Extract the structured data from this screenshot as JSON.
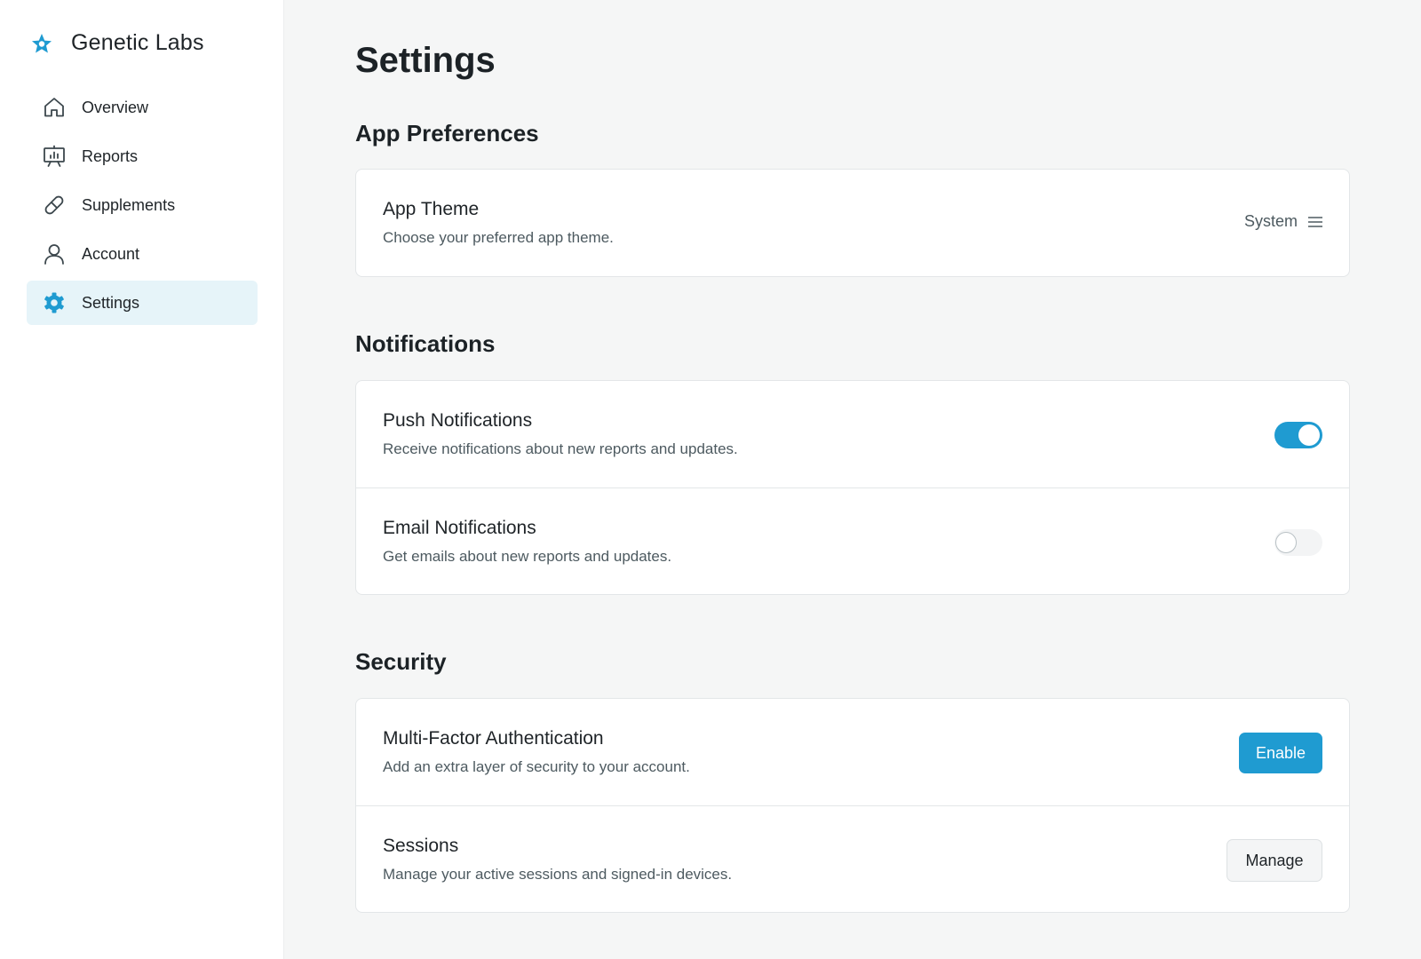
{
  "app": {
    "name": "Genetic Labs"
  },
  "colors": {
    "accent": "#1f9bd1",
    "active_bg": "#e6f4f9",
    "page_bg": "#f5f6f6"
  },
  "sidebar": {
    "items": [
      {
        "label": "Overview",
        "icon": "home-icon"
      },
      {
        "label": "Reports",
        "icon": "presentation-chart-icon"
      },
      {
        "label": "Supplements",
        "icon": "pill-icon"
      },
      {
        "label": "Account",
        "icon": "user-icon"
      },
      {
        "label": "Settings",
        "icon": "gear-icon",
        "active": true
      }
    ]
  },
  "page": {
    "title": "Settings"
  },
  "sections": {
    "app_preferences": {
      "title": "App Preferences",
      "theme": {
        "title": "App Theme",
        "description": "Choose your preferred app theme.",
        "value": "System",
        "icon": "menu-icon"
      }
    },
    "notifications": {
      "title": "Notifications",
      "push": {
        "title": "Push Notifications",
        "description": "Receive notifications about new reports and updates.",
        "enabled": true
      },
      "email": {
        "title": "Email Notifications",
        "description": "Get emails about new reports and updates.",
        "enabled": false
      }
    },
    "security": {
      "title": "Security",
      "mfa": {
        "title": "Multi-Factor Authentication",
        "description": "Add an extra layer of security to your account.",
        "button": "Enable"
      },
      "sessions": {
        "title": "Sessions",
        "description": "Manage your active sessions and signed-in devices.",
        "button": "Manage"
      }
    }
  }
}
